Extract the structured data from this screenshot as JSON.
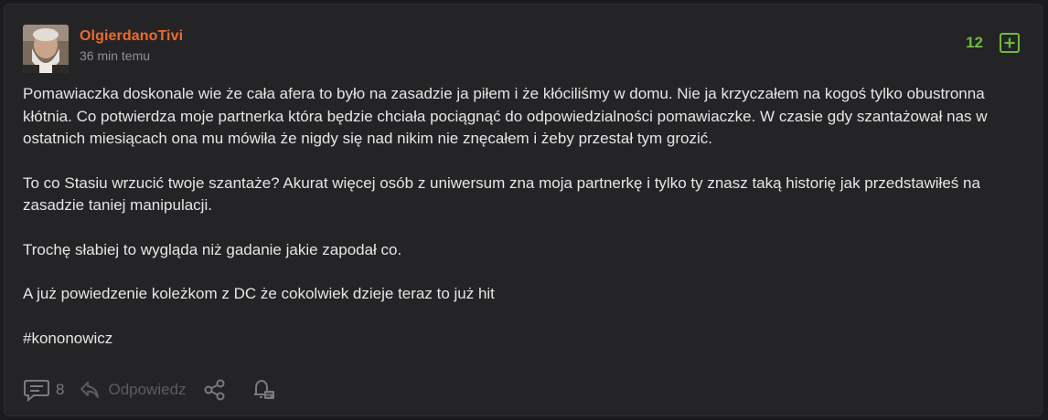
{
  "post": {
    "author": "OlgierdanoTivi",
    "time": "36 min temu",
    "votes": "12",
    "paragraphs": [
      "Pomawiaczka doskonale wie że cała afera to było na zasadzie ja piłem i że kłóciliśmy w domu. Nie ja krzyczałem na kogoś tylko obustronna kłótnia. Co potwierdza moje partnerka która będzie chciała pociągnąć do odpowiedzialności pomawiaczke. W czasie gdy szantażował nas w ostatnich miesiącach ona mu mówiła że nigdy się nad nikim nie znęcałem i żeby przestał tym grozić.",
      "To co Stasiu wrzucić twoje szantaże? Akurat więcej osób z uniwersum zna moja partnerkę i tylko ty znasz taką historię jak przedstawiłeś na zasadzie taniej manipulacji.",
      "Trochę słabiej to wygląda niż gadanie jakie zapodał co.",
      "A już powiedzenie koleżkom z DC że cokolwiek dzieje teraz to już hit"
    ],
    "tag": "#kononowicz"
  },
  "actions": {
    "comments_count": "8",
    "reply_label": "Odpowiedz"
  },
  "icons": {
    "plus": "plus-square-icon",
    "comments": "comment-bubble-icon",
    "reply": "reply-arrow-icon",
    "share": "share-icon",
    "watch": "bell-icon"
  },
  "colors": {
    "author": "#ee6a2c",
    "votes": "#6dbb3e",
    "background": "#242426"
  }
}
